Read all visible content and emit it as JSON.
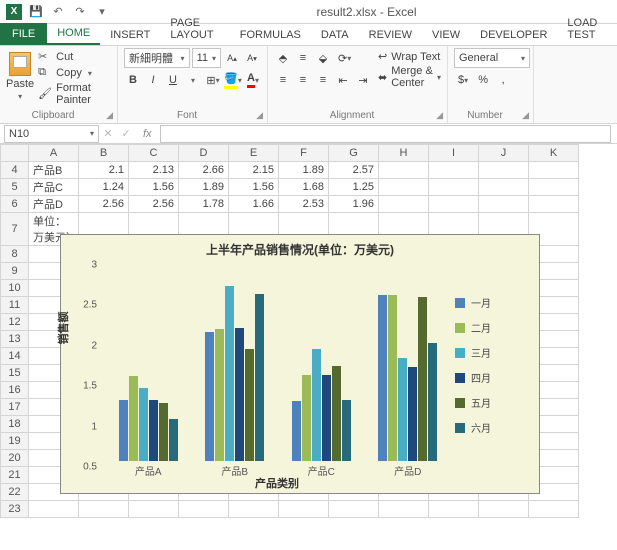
{
  "window": {
    "title": "result2.xlsx - Excel"
  },
  "qat": {
    "save": "💾",
    "undo": "↶",
    "redo": "↷",
    "more": "▾"
  },
  "tabs": [
    "FILE",
    "HOME",
    "INSERT",
    "PAGE LAYOUT",
    "FORMULAS",
    "DATA",
    "REVIEW",
    "VIEW",
    "DEVELOPER",
    "LOAD TEST"
  ],
  "ribbon": {
    "clipboard": {
      "label": "Clipboard",
      "paste": "Paste",
      "cut": "Cut",
      "copy": "Copy",
      "fmt": "Format Painter"
    },
    "font": {
      "label": "Font",
      "family": "新細明體",
      "size": "11",
      "bold": "B",
      "italic": "I",
      "underline": "U",
      "inc": "A▴",
      "dec": "A▾"
    },
    "alignment": {
      "label": "Alignment",
      "wrap": "Wrap Text",
      "merge": "Merge & Center"
    },
    "number": {
      "label": "Number",
      "format": "General"
    }
  },
  "namebox": "N10",
  "sheet": {
    "columns": [
      "A",
      "B",
      "C",
      "D",
      "E",
      "F",
      "G",
      "H",
      "I",
      "J",
      "K"
    ],
    "rows": [
      {
        "n": 4,
        "label": "产品B",
        "vals": [
          "2.1",
          "2.13",
          "2.66",
          "2.15",
          "1.89",
          "2.57"
        ]
      },
      {
        "n": 5,
        "label": "产品C",
        "vals": [
          "1.24",
          "1.56",
          "1.89",
          "1.56",
          "1.68",
          "1.25"
        ]
      },
      {
        "n": 6,
        "label": "产品D",
        "vals": [
          "2.56",
          "2.56",
          "1.78",
          "1.66",
          "2.53",
          "1.96"
        ]
      },
      {
        "n": 7,
        "label": "单位：万美元）",
        "vals": []
      }
    ],
    "blank_rows": [
      8,
      9,
      10,
      11,
      12,
      13,
      14,
      15,
      16,
      17,
      18,
      19,
      20,
      21,
      22,
      23
    ]
  },
  "chart_data": {
    "type": "bar",
    "title": "上半年产品销售情况(单位：万美元)",
    "xlabel": "产品类别",
    "ylabel": "销售额",
    "ylim": [
      0.5,
      3
    ],
    "yticks": [
      0.5,
      1,
      1.5,
      2,
      2.5,
      3
    ],
    "categories": [
      "产品A",
      "产品B",
      "产品C",
      "产品D"
    ],
    "series": [
      {
        "name": "一月",
        "color": "c0",
        "values": [
          1.25,
          2.1,
          1.24,
          2.56
        ]
      },
      {
        "name": "二月",
        "color": "c1",
        "values": [
          1.55,
          2.13,
          1.56,
          2.56
        ]
      },
      {
        "name": "三月",
        "color": "c2",
        "values": [
          1.4,
          2.66,
          1.89,
          1.78
        ]
      },
      {
        "name": "四月",
        "color": "c3",
        "values": [
          1.25,
          2.15,
          1.56,
          1.66
        ]
      },
      {
        "name": "五月",
        "color": "c4",
        "values": [
          1.22,
          1.89,
          1.68,
          2.53
        ]
      },
      {
        "name": "六月",
        "color": "c5",
        "values": [
          1.02,
          2.57,
          1.25,
          1.96
        ]
      }
    ]
  }
}
